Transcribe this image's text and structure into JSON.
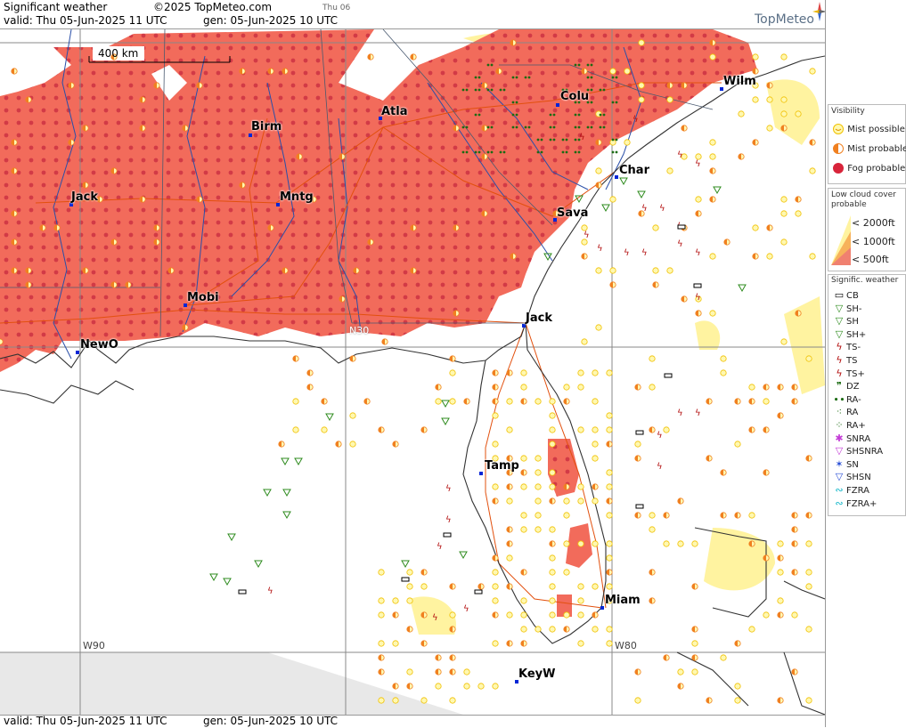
{
  "header": {
    "title": "Significant weather",
    "copyright": "©2025 TopMeteo.com",
    "day": "Thu 06",
    "valid": "valid:  Thu  05-Jun-2025  11 UTC",
    "gen": "gen:  05-Jun-2025 10 UTC",
    "logo": "TopMeteo"
  },
  "footer": {
    "valid": "valid:  Thu  05-Jun-2025  11 UTC",
    "gen": "gen:  05-Jun-2025 10 UTC"
  },
  "map": {
    "scale_label": "400 km",
    "grid_labels": {
      "n30": "N30",
      "w90": "W90",
      "w80": "W80"
    },
    "cities": [
      {
        "id": "jack-ms",
        "name": "Jack"
      },
      {
        "id": "birm",
        "name": "Birm"
      },
      {
        "id": "atla",
        "name": "Atla"
      },
      {
        "id": "colu",
        "name": "Colu"
      },
      {
        "id": "wilm",
        "name": "Wilm"
      },
      {
        "id": "char",
        "name": "Char"
      },
      {
        "id": "mntg",
        "name": "Mntg"
      },
      {
        "id": "sava",
        "name": "Sava"
      },
      {
        "id": "mobi",
        "name": "Mobi"
      },
      {
        "id": "newo",
        "name": "NewO"
      },
      {
        "id": "jack-fl",
        "name": "Jack"
      },
      {
        "id": "tamp",
        "name": "Tamp"
      },
      {
        "id": "miam",
        "name": "Miam"
      },
      {
        "id": "keyw",
        "name": "KeyW"
      }
    ],
    "colors": {
      "fog": "#f26b5b",
      "fog_dot": "#c8243a",
      "mist": "#ffd400",
      "low_cloud": "#fff3a0",
      "rain": "#1c6b13",
      "shower": "#2e8b1e",
      "thunder": "#b30f0f",
      "river": "#2a4fa8",
      "road": "#e2500e",
      "coast": "#333333"
    }
  },
  "legend": {
    "visibility": {
      "title": "Visibility",
      "items": [
        {
          "icon": "mist-possible-icon",
          "label": "Mist possible"
        },
        {
          "icon": "mist-probable-icon",
          "label": "Mist probable"
        },
        {
          "icon": "fog-probable-icon",
          "label": "Fog probable"
        }
      ]
    },
    "low_cloud": {
      "title": "Low cloud cover probable",
      "items": [
        {
          "label": "< 2000ft"
        },
        {
          "label": "< 1000ft"
        },
        {
          "label": "<   500ft"
        }
      ]
    },
    "signif": {
      "title": "Signific. weather",
      "items": [
        {
          "icon": "cb-icon",
          "label": "CB"
        },
        {
          "icon": "shower-light-icon",
          "label": "SH-"
        },
        {
          "icon": "shower-icon",
          "label": "SH"
        },
        {
          "icon": "shower-heavy-icon",
          "label": "SH+"
        },
        {
          "icon": "thunderstorm-light-icon",
          "label": "TS-"
        },
        {
          "icon": "thunderstorm-icon",
          "label": "TS"
        },
        {
          "icon": "thunderstorm-heavy-icon",
          "label": "TS+"
        },
        {
          "icon": "drizzle-icon",
          "label": "DZ"
        },
        {
          "icon": "rain-light-icon",
          "label": "RA-"
        },
        {
          "icon": "rain-icon",
          "label": "RA"
        },
        {
          "icon": "rain-heavy-icon",
          "label": "RA+"
        },
        {
          "icon": "snow-rain-icon",
          "label": "SNRA"
        },
        {
          "icon": "shower-snow-rain-icon",
          "label": "SHSNRA"
        },
        {
          "icon": "snow-icon",
          "label": "SN"
        },
        {
          "icon": "shower-snow-icon",
          "label": "SHSN"
        },
        {
          "icon": "freezing-rain-icon",
          "label": "FZRA"
        },
        {
          "icon": "freezing-rain-heavy-icon",
          "label": "FZRA+"
        }
      ]
    }
  }
}
